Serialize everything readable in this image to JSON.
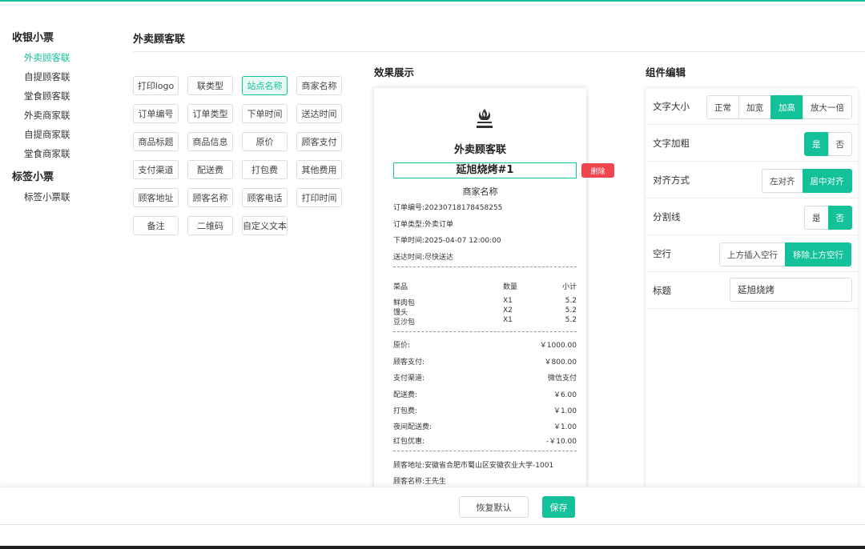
{
  "nav": {
    "group1": "收银小票",
    "group1_items": [
      "外卖顾客联",
      "自提顾客联",
      "堂食顾客联",
      "外卖商家联",
      "自提商家联",
      "堂食商家联"
    ],
    "group2": "标签小票",
    "group2_items": [
      "标签小票联"
    ],
    "active_item": "外卖顾客联"
  },
  "page_title": "外卖顾客联",
  "components": [
    [
      "打印logo",
      "联类型",
      "站点名称",
      "商家名称"
    ],
    [
      "订单编号",
      "订单类型",
      "下单时间",
      "送达时间"
    ],
    [
      "商品标题",
      "商品信息",
      "原价",
      "顾客支付"
    ],
    [
      "支付渠道",
      "配送费",
      "打包费",
      "其他费用"
    ],
    [
      "顾客地址",
      "顾客名称",
      "顾客电话",
      "打印时间"
    ],
    [
      "备注",
      "二维码",
      "自定义文本"
    ]
  ],
  "active_component": "站点名称",
  "preview": {
    "label": "效果展示",
    "copy_type": "外卖顾客联",
    "shop_name": "延旭烧烤#1",
    "merchant_name": "商家名称",
    "order_no": "订单编号:20230718178458255",
    "order_type": "订单类型:外卖订单",
    "order_time": "下单时间:2025-04-07 12:00:00",
    "delivery_time": "送达时间:尽快送达",
    "table_headers": {
      "name": "菜品",
      "qty": "数量",
      "subtotal": "小计"
    },
    "items": [
      {
        "name": "鲜肉包",
        "qty": "X1",
        "subtotal": "5.2"
      },
      {
        "name": "馒头",
        "qty": "X2",
        "subtotal": "5.2"
      },
      {
        "name": "豆沙包",
        "qty": "X1",
        "subtotal": "5.2"
      }
    ],
    "amounts": [
      {
        "label": "原价:",
        "value": "￥1000.00"
      },
      {
        "label": "顾客支付:",
        "value": "￥800.00"
      },
      {
        "label": "支付渠道:",
        "value": "微信支付"
      },
      {
        "label": "配送费:",
        "value": "￥6.00"
      },
      {
        "label": "打包费:",
        "value": "￥1.00"
      },
      {
        "label": "夜间配送费:",
        "value": "￥1.00"
      },
      {
        "label": "红包优惠:",
        "value": "-￥10.00"
      }
    ],
    "customer_address": "顾客地址:安徽省合肥市蜀山区安徽农业大学-1001",
    "customer_name": "顾客名称:王先生",
    "delete_label": "删除"
  },
  "editor": {
    "label": "组件编辑",
    "font_size": {
      "label": "文字大小",
      "options": [
        "正常",
        "加宽",
        "加高",
        "放大一倍"
      ],
      "selected": "加高"
    },
    "bold": {
      "label": "文字加粗",
      "options": [
        "是",
        "否"
      ],
      "selected": "是"
    },
    "align": {
      "label": "对齐方式",
      "options": [
        "左对齐",
        "居中对齐"
      ],
      "selected": "居中对齐"
    },
    "divider": {
      "label": "分割线",
      "options": [
        "是",
        "否"
      ],
      "selected": "否"
    },
    "blank_line": {
      "label": "空行",
      "options": [
        "上方插入空行",
        "移除上方空行"
      ],
      "selected": "移除上方空行"
    },
    "title": {
      "label": "标题",
      "value": "延旭烧烤"
    }
  },
  "footer": {
    "reset_label": "恢复默认",
    "save_label": "保存"
  },
  "colors": {
    "accent": "#13c29a",
    "danger": "#f0454d"
  }
}
